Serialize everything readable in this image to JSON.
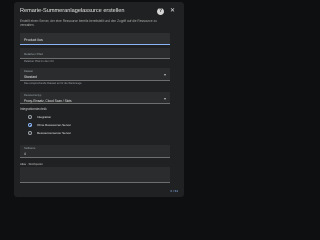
{
  "dialog": {
    "title": "Remarie-Summeranlagelassurce erstellen",
    "description": "Erstellt einen Server, der eine Ressource bereits bereitstellt und den Zugriff auf die Ressource zu verwalten."
  },
  "fields": {
    "name": {
      "value": "Product ilus"
    },
    "rel_path": {
      "placeholder": "Relativer Pfad",
      "hint": "Relativer Pfad zu dem Ort"
    },
    "dataset": {
      "label": "Dataset",
      "value": "Standard",
      "hint": "Das entsprechende Dataset an für die Werkzeuge."
    },
    "type": {
      "label": "Ressourcentyp",
      "value": "Proxy-Einsatz, Cloud Scan / Slots"
    },
    "number": {
      "label": "Stellwerte",
      "value": "4"
    }
  },
  "visibility": {
    "heading": "Integrationstechnik",
    "options": [
      {
        "label": "Integration",
        "checked": false
      },
      {
        "label": "Ohne Ressourcen-Server",
        "checked": true
      },
      {
        "label": "Ressourcenserver Server",
        "checked": false
      }
    ]
  },
  "footer": {
    "label": "Alias · Strichpunkt",
    "counter": "0 / 64"
  },
  "colors": {
    "accent": "#8ab4f8",
    "dialog_bg": "#202122",
    "page_bg": "#0e0f10"
  },
  "icons": {
    "help": "help-circle-icon",
    "close": "close-icon",
    "dropdown": "chevron-down-icon"
  }
}
